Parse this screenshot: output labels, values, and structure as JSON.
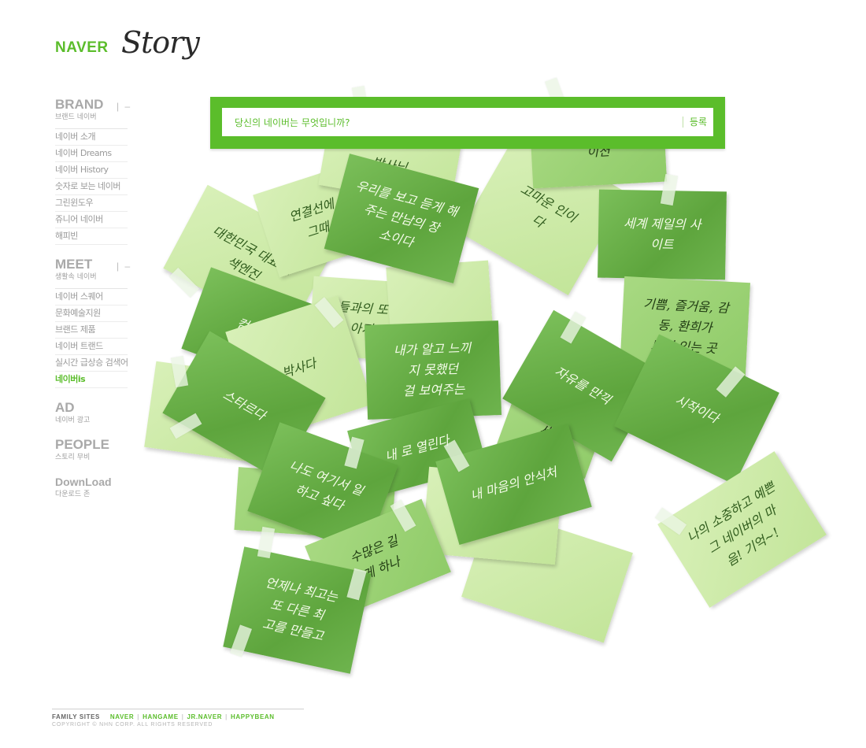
{
  "brand": {
    "naver": "NAVER",
    "story": "Story"
  },
  "colors": {
    "accent": "#5bbd2b",
    "note_dark": "#6aae47",
    "note_mid": "#98cf72",
    "note_light": "#cdeaa8"
  },
  "search": {
    "placeholder": "당신의 네이버는 무엇입니까?",
    "submit": "등록"
  },
  "sidebar": {
    "brand": {
      "title": "BRAND",
      "subtitle": "브랜드 네이버",
      "toggle": "–",
      "items": [
        "네이버 소개",
        "네이버 Dreams",
        "네이버 History",
        "숫자로 보는 네이버",
        "그린윈도우",
        "쥬니어 네이버",
        "해피빈"
      ]
    },
    "meet": {
      "title": "MEET",
      "subtitle": "생활속 네이버",
      "toggle": "–",
      "items": [
        "네이버 스퀘어",
        "문화예술지원",
        "브랜드 제품",
        "네이버 트랜드",
        "실시간 급상승 검색어",
        "네이버is"
      ]
    },
    "ad": {
      "title": "AD",
      "subtitle": "네이버 광고"
    },
    "people": {
      "title": "PEOPLE",
      "subtitle": "스토리 무비"
    },
    "download": {
      "title": "DownLoad",
      "subtitle": "다운로드 존"
    }
  },
  "notes": [
    "대한민국 대표 검\n색엔진",
    "연결선에\n그때",
    "박사님",
    "우리를 보고 듣게 해\n주는 만남의 장\n소이다",
    "이션",
    "고마운 인이\n다",
    "세계 제일의 사\n이트",
    "컴퓨",
    "들과의 또\n아지",
    "박사다",
    "스타르다",
    "내가 알고 느끼\n지 못했던\n걸 보여주는",
    "기쁨, 즐거움, 감\n동, 환희가\n모여 있는 곳",
    "자유를 만끽",
    "시작이다",
    "세상",
    "내 로 열린다",
    "나도 여기서 일\n하고 싶다",
    "내 마음의 안식처",
    "나의 소중하고 예쁜\n그 네이버의 마\n음! 기억~!",
    "수많은 길\n게 하나",
    "언제나 최고는\n또 다른 최\n고를 만들고"
  ],
  "footer": {
    "family_label": "FAMILY SITES",
    "links": [
      "NAVER",
      "HANGAME",
      "JR.NAVER",
      "HAPPYBEAN"
    ],
    "copyright": "COPYRIGHT © NHN CORP. ALL RIGHTS RESERVED"
  }
}
